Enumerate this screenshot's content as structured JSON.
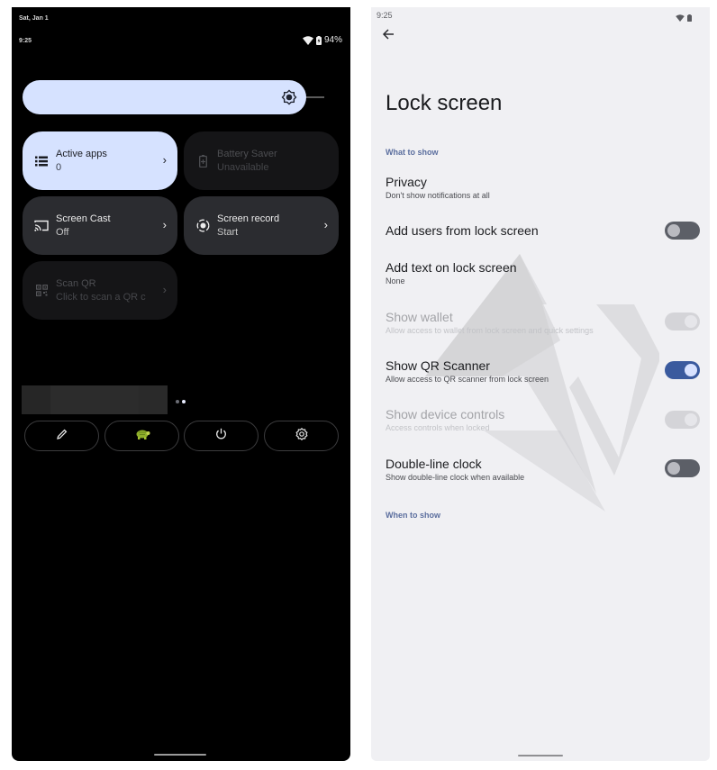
{
  "quick_settings": {
    "date": "Sat, Jan 1",
    "time": "9:25",
    "battery_percent": "94%",
    "status_icons": [
      "wifi-icon",
      "battery-charging-icon"
    ],
    "brightness": {
      "icon": "brightness-icon",
      "level_fraction": 1.0,
      "color": "#d6e2ff"
    },
    "tiles": [
      {
        "title": "Active apps",
        "subtitle": "0",
        "icon": "list-icon",
        "state": "active",
        "chevron": true
      },
      {
        "title": "Battery Saver",
        "subtitle": "Unavailable",
        "icon": "battery-saver-icon",
        "state": "unavailable",
        "chevron": false
      },
      {
        "title": "Screen Cast",
        "subtitle": "Off",
        "icon": "cast-icon",
        "state": "inactive",
        "chevron": true
      },
      {
        "title": "Screen record",
        "subtitle": "Start",
        "icon": "screen-record-icon",
        "state": "inactive",
        "chevron": true
      },
      {
        "title": "Scan QR",
        "subtitle": "Click to scan a QR c",
        "icon": "qr-code-icon",
        "state": "unavailable",
        "chevron": true
      }
    ],
    "page_indicator": {
      "pages": 2,
      "current": 2
    },
    "footer_buttons": [
      "edit-icon",
      "user-avatar-icon",
      "power-icon",
      "settings-icon"
    ]
  },
  "settings": {
    "time": "9:25",
    "status_icons": [
      "wifi-icon",
      "battery-icon"
    ],
    "title": "Lock screen",
    "sections": {
      "what_to_show": "What to show",
      "when_to_show": "When to show"
    },
    "prefs": [
      {
        "title": "Privacy",
        "summary": "Don't show notifications at all",
        "toggle": null,
        "enabled": true
      },
      {
        "title": "Add users from lock screen",
        "summary": "",
        "toggle": false,
        "enabled": true
      },
      {
        "title": "Add text on lock screen",
        "summary": "None",
        "toggle": null,
        "enabled": true
      },
      {
        "title": "Show wallet",
        "summary": "Allow access to wallet from lock screen and quick settings",
        "toggle": true,
        "enabled": false
      },
      {
        "title": "Show QR Scanner",
        "summary": "Allow access to QR scanner from lock screen",
        "toggle": true,
        "enabled": true
      },
      {
        "title": "Show device controls",
        "summary": "Access controls when locked",
        "toggle": true,
        "enabled": false
      },
      {
        "title": "Double-line clock",
        "summary": "Show double-line clock when available",
        "toggle": false,
        "enabled": true
      }
    ],
    "accent_color": "#3a5a9e"
  }
}
